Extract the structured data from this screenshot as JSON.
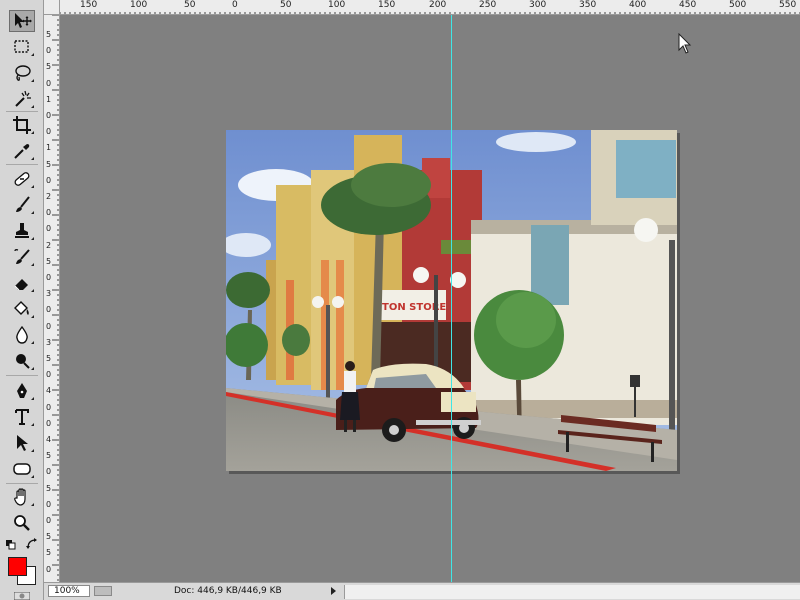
{
  "toolbar": {
    "tools": [
      {
        "name": "move-tool",
        "icon": "move-icon",
        "active": true
      },
      {
        "name": "rectangular-marquee-tool",
        "icon": "marquee-icon"
      },
      {
        "name": "lasso-tool",
        "icon": "lasso-icon"
      },
      {
        "name": "magic-wand-tool",
        "icon": "magic-wand-icon"
      },
      {
        "name": "crop-tool",
        "icon": "crop-icon"
      },
      {
        "name": "eyedropper-tool",
        "icon": "eyedropper-icon"
      },
      {
        "name": "healing-brush-tool",
        "icon": "bandage-icon"
      },
      {
        "name": "brush-tool",
        "icon": "brush-icon"
      },
      {
        "name": "clone-stamp-tool",
        "icon": "stamp-icon"
      },
      {
        "name": "history-brush-tool",
        "icon": "history-brush-icon"
      },
      {
        "name": "eraser-tool",
        "icon": "eraser-icon"
      },
      {
        "name": "paint-bucket-tool",
        "icon": "paint-bucket-icon"
      },
      {
        "name": "blur-tool",
        "icon": "drop-icon"
      },
      {
        "name": "dodge-tool",
        "icon": "dodge-icon"
      },
      {
        "name": "pen-tool",
        "icon": "pen-icon"
      },
      {
        "name": "type-tool",
        "icon": "type-icon"
      },
      {
        "name": "path-selection-tool",
        "icon": "arrow-select-icon"
      },
      {
        "name": "shape-tool",
        "icon": "rounded-rect-icon"
      },
      {
        "name": "hand-tool",
        "icon": "hand-icon"
      },
      {
        "name": "zoom-tool",
        "icon": "zoom-icon"
      }
    ],
    "foreground_color": "#ff0000",
    "background_color": "#ffffff"
  },
  "rulers": {
    "horizontal_labels": [
      "150",
      "100",
      "50",
      "0",
      "50",
      "100",
      "150",
      "200",
      "250",
      "300",
      "350",
      "400",
      "450",
      "500",
      "550"
    ],
    "vertical_labels": [
      "5",
      "0",
      "5",
      "0",
      "1",
      "0",
      "0",
      "1",
      "5",
      "0",
      "2",
      "0",
      "0",
      "2",
      "5",
      "0",
      "3",
      "0",
      "0",
      "3",
      "5",
      "0",
      "4",
      "0",
      "0",
      "4",
      "5",
      "0",
      "5",
      "0",
      "0",
      "5",
      "5",
      "0"
    ]
  },
  "status": {
    "zoom": "100%",
    "doc_info": "Doc: 446,9 KB/446,9 KB"
  },
  "colors": {
    "workspace": "#808080",
    "guide": "#3fe6e6",
    "panel": "#d6d6d6"
  }
}
